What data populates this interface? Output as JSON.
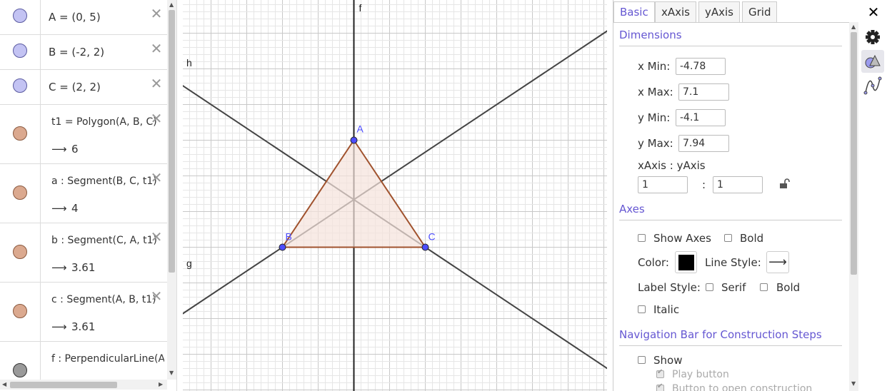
{
  "algebra": {
    "items": [
      {
        "definition": "A = (0, 5)",
        "color": "#c3c3f3"
      },
      {
        "definition": "B = (-2, 2)",
        "color": "#c3c3f3"
      },
      {
        "definition": "C = (2, 2)",
        "color": "#c3c3f3"
      },
      {
        "definition": "t1 = Polygon(A, B, C)",
        "value": "6",
        "color": "#dba98f"
      },
      {
        "definition": "a : Segment(B, C, t1)",
        "value": "4",
        "color": "#dba98f"
      },
      {
        "definition": "b : Segment(C, A, t1)",
        "value": "3.61",
        "color": "#dba98f"
      },
      {
        "definition": "c : Segment(A, B, t1)",
        "value": "3.61",
        "color": "#dba98f"
      },
      {
        "definition": "f : PerpendicularLine(A",
        "color": "#9a9a9a"
      }
    ],
    "arrow": "⟶"
  },
  "graphics": {
    "point_labels": {
      "A": "A",
      "B": "B",
      "C": "C"
    },
    "line_labels": {
      "f": "f",
      "g": "g",
      "h": "h"
    },
    "points": {
      "A": [
        0,
        5
      ],
      "B": [
        -2,
        2
      ],
      "C": [
        2,
        2
      ]
    },
    "view": {
      "xmin": -4.78,
      "xmax": 7.1,
      "ymin": -4.1,
      "ymax": 7.94
    },
    "colors": {
      "point": "#4d4dff",
      "polygon_stroke": "#a0522d",
      "polygon_fill": "#f5e3dc",
      "line": "#444444",
      "axis": "#222222",
      "grid_minor": "#e6e6e6",
      "grid_major": "#c8c8c8"
    }
  },
  "props": {
    "tabs": [
      "Basic",
      "xAxis",
      "yAxis",
      "Grid"
    ],
    "active_tab": "Basic",
    "dimensions": {
      "title": "Dimensions",
      "xmin_label": "x Min:",
      "xmin": "-4.78",
      "xmax_label": "x Max:",
      "xmax": "7.1",
      "ymin_label": "y Min:",
      "ymin": "-4.1",
      "ymax_label": "y Max:",
      "ymax": "7.94",
      "ratio_label": "xAxis : yAxis",
      "ratio_x": "1",
      "ratio_sep": ":",
      "ratio_y": "1"
    },
    "axes": {
      "title": "Axes",
      "show_axes": "Show Axes",
      "bold": "Bold",
      "color_label": "Color:",
      "color": "#000000",
      "line_style_label": "Line Style:",
      "line_style": "⟶",
      "label_style_label": "Label Style:",
      "serif": "Serif",
      "bold2": "Bold",
      "italic": "Italic"
    },
    "navbar": {
      "title": "Navigation Bar for Construction Steps",
      "show": "Show",
      "play_button": "Play button",
      "open_construction": "Button to open construction"
    }
  },
  "rail": {
    "close": "✕"
  }
}
